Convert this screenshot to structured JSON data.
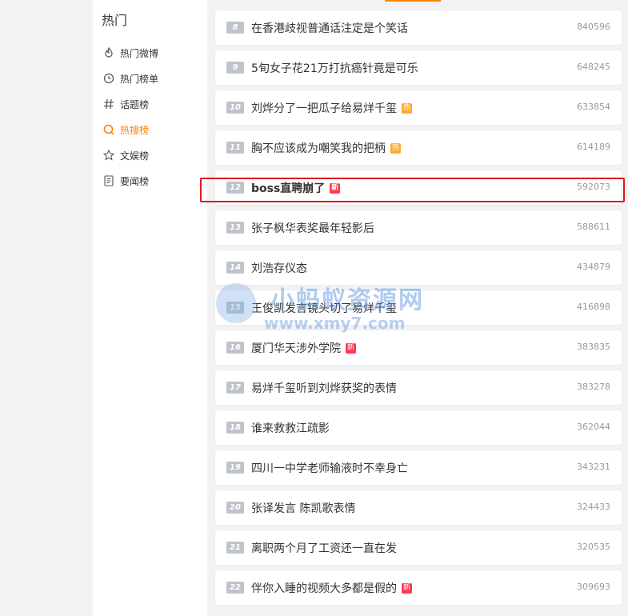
{
  "sidebar": {
    "title": "热门",
    "items": [
      {
        "label": "热门微博",
        "icon": "flame-icon",
        "active": false
      },
      {
        "label": "热门榜单",
        "icon": "clock-icon",
        "active": false
      },
      {
        "label": "话题榜",
        "icon": "hash-icon",
        "active": false
      },
      {
        "label": "热搜榜",
        "icon": "search-icon",
        "active": true
      },
      {
        "label": "文娱榜",
        "icon": "star-icon",
        "active": false
      },
      {
        "label": "要闻榜",
        "icon": "document-icon",
        "active": false
      }
    ]
  },
  "list": [
    {
      "rank": "8",
      "title": "在香港歧视普通话注定是个笑话",
      "count": "840596",
      "badge": ""
    },
    {
      "rank": "9",
      "title": "5旬女子花21万打抗癌针竟是可乐",
      "count": "648245",
      "badge": ""
    },
    {
      "rank": "10",
      "title": "刘烨分了一把瓜子给易烊千玺",
      "count": "633854",
      "badge": "热"
    },
    {
      "rank": "11",
      "title": "胸不应该成为嘲笑我的把柄",
      "count": "614189",
      "badge": "热"
    },
    {
      "rank": "12",
      "title": "boss直聘崩了",
      "count": "592073",
      "badge": "新"
    },
    {
      "rank": "13",
      "title": "张子枫华表奖最年轻影后",
      "count": "588611",
      "badge": ""
    },
    {
      "rank": "14",
      "title": "刘浩存仪态",
      "count": "434879",
      "badge": ""
    },
    {
      "rank": "15",
      "title": "王俊凯发言镜头切了易烊千玺",
      "count": "416898",
      "badge": ""
    },
    {
      "rank": "16",
      "title": "厦门华天涉外学院",
      "count": "383835",
      "badge": "新"
    },
    {
      "rank": "17",
      "title": "易烊千玺听到刘烨获奖的表情",
      "count": "383278",
      "badge": ""
    },
    {
      "rank": "18",
      "title": "谁来救救江疏影",
      "count": "362044",
      "badge": ""
    },
    {
      "rank": "19",
      "title": "四川一中学老师输液时不幸身亡",
      "count": "343231",
      "badge": ""
    },
    {
      "rank": "20",
      "title": "张译发言 陈凯歌表情",
      "count": "324433",
      "badge": ""
    },
    {
      "rank": "21",
      "title": "离职两个月了工资还一直在发",
      "count": "320535",
      "badge": ""
    },
    {
      "rank": "22",
      "title": "伴你入睡的视频大多都是假的",
      "count": "309693",
      "badge": "新"
    }
  ],
  "watermark": {
    "line1": "小蚂蚁资源网",
    "line2": "www.xmy7.com"
  },
  "colors": {
    "accent": "#ff8200",
    "hot": "#ffab2d",
    "new": "#ff3852",
    "highlight": "#e01b1b"
  }
}
